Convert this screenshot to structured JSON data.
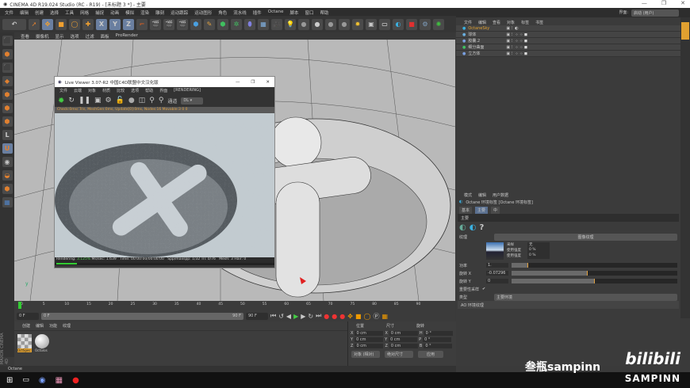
{
  "window": {
    "title": "CINEMA 4D R19.024 Studio (RC - R19) - [未标题 3 *] - 主要",
    "controls": [
      "—",
      "❐",
      "✕"
    ]
  },
  "menu": [
    "文件",
    "编辑",
    "创建",
    "选择",
    "工具",
    "网格",
    "捕捉",
    "动画",
    "模拟",
    "渲染",
    "雕刻",
    "运动跟踪",
    "运动图形",
    "角色",
    "流水线",
    "插件",
    "Octane",
    "脚本",
    "窗口",
    "帮助"
  ],
  "toolbar": {
    "undo": "↶",
    "axes": [
      "X",
      "Y",
      "Z"
    ]
  },
  "viewport_menu": [
    "查看",
    "摄像机",
    "显示",
    "选项",
    "过滤",
    "面板",
    "ProRender"
  ],
  "layout": {
    "label": "界面:",
    "value": "启动 (用户)"
  },
  "object_manager": {
    "menu": [
      "文件",
      "编辑",
      "查看",
      "对象",
      "标签",
      "书签"
    ],
    "objects": [
      "OctaneSky",
      "球体",
      "胶囊.2",
      "细分曲面",
      "立方体"
    ]
  },
  "attributes": {
    "menu": [
      "模式",
      "编辑",
      "用户数据"
    ],
    "title": "Octane 环境标签 [Octane 环境标签]",
    "tabs": [
      "基本",
      "主要",
      "中"
    ],
    "section": "主要",
    "texture_label": "纹理",
    "texture_value": "图像纹理",
    "sub": [
      {
        "label": "采样",
        "value": "无"
      },
      {
        "label": "使用强度",
        "value": "0 %"
      },
      {
        "label": "使用强度",
        "value": "0 %"
      }
    ],
    "params": [
      {
        "label": "功率",
        "value": "1.",
        "fill": 0.1
      },
      {
        "label": "旋转 X",
        "value": "-0.07296",
        "fill": 0.46
      },
      {
        "label": "旋转 Y",
        "value": "0",
        "fill": 0.5
      }
    ],
    "importance_label": "重要性采样",
    "importance_checked": true,
    "type_label": "类型",
    "type_value": "主要环境",
    "ao_label": "AO 环境纹理"
  },
  "live_viewer": {
    "title": "Live Viewer 3.07-R2 中国C4D联盟中文汉化版",
    "menu": [
      "文件",
      "云端",
      "对象",
      "材质",
      "比较",
      "选项",
      "帮助",
      "界面",
      "[RENDERING]"
    ],
    "channel_label": "通道",
    "channel_value": "DL",
    "check": "Check:0ms/.Tris, MeshGen:0ms, Update[0]:0ms, Nodes:16 Movable:3  0 0",
    "status": {
      "rendering": "Rendering:",
      "pct": "3.125%",
      "ms": "Ms/sec: 1.639",
      "time": "Time: 00:00:00/00:00:00",
      "spp": "Spp/maxspp: 1/32",
      "tri": "Tri: 0/76",
      "mesh": "Mesh: 3",
      "hair": "Hair: 0"
    },
    "progress": 0.03125
  },
  "timeline": {
    "ticks": [
      "0",
      "5",
      "10",
      "15",
      "20",
      "25",
      "30",
      "35",
      "40",
      "45",
      "50",
      "55",
      "60",
      "65",
      "70",
      "75",
      "80",
      "85",
      "90"
    ],
    "current": "0 F",
    "start": "0 F",
    "end": "90 F",
    "end_field": "90 F",
    "range_start": "0 F"
  },
  "materials": {
    "menu": [
      "创建",
      "编辑",
      "功能",
      "纹理"
    ],
    "items": [
      "OctSpec",
      "OctGlos"
    ]
  },
  "coords": {
    "headers": [
      "位置",
      "尺寸",
      "旋转"
    ],
    "rows": [
      [
        "X",
        "0 cm",
        "X",
        "0 cm",
        "H",
        "0 °"
      ],
      [
        "Y",
        "0 cm",
        "Y",
        "0 cm",
        "P",
        "0 °"
      ],
      [
        "Z",
        "0 cm",
        "Z",
        "0 cm",
        "B",
        "0 °"
      ]
    ],
    "mode": "对象 (相对)",
    "size_mode": "绝对尺寸",
    "apply": "应用"
  },
  "statusbar": "Octane",
  "brand": "MAXON CINEMA 4D",
  "watermark": {
    "text": "叁瓶sampinn",
    "logo": "bilibili",
    "sub": "SAMPINN"
  }
}
